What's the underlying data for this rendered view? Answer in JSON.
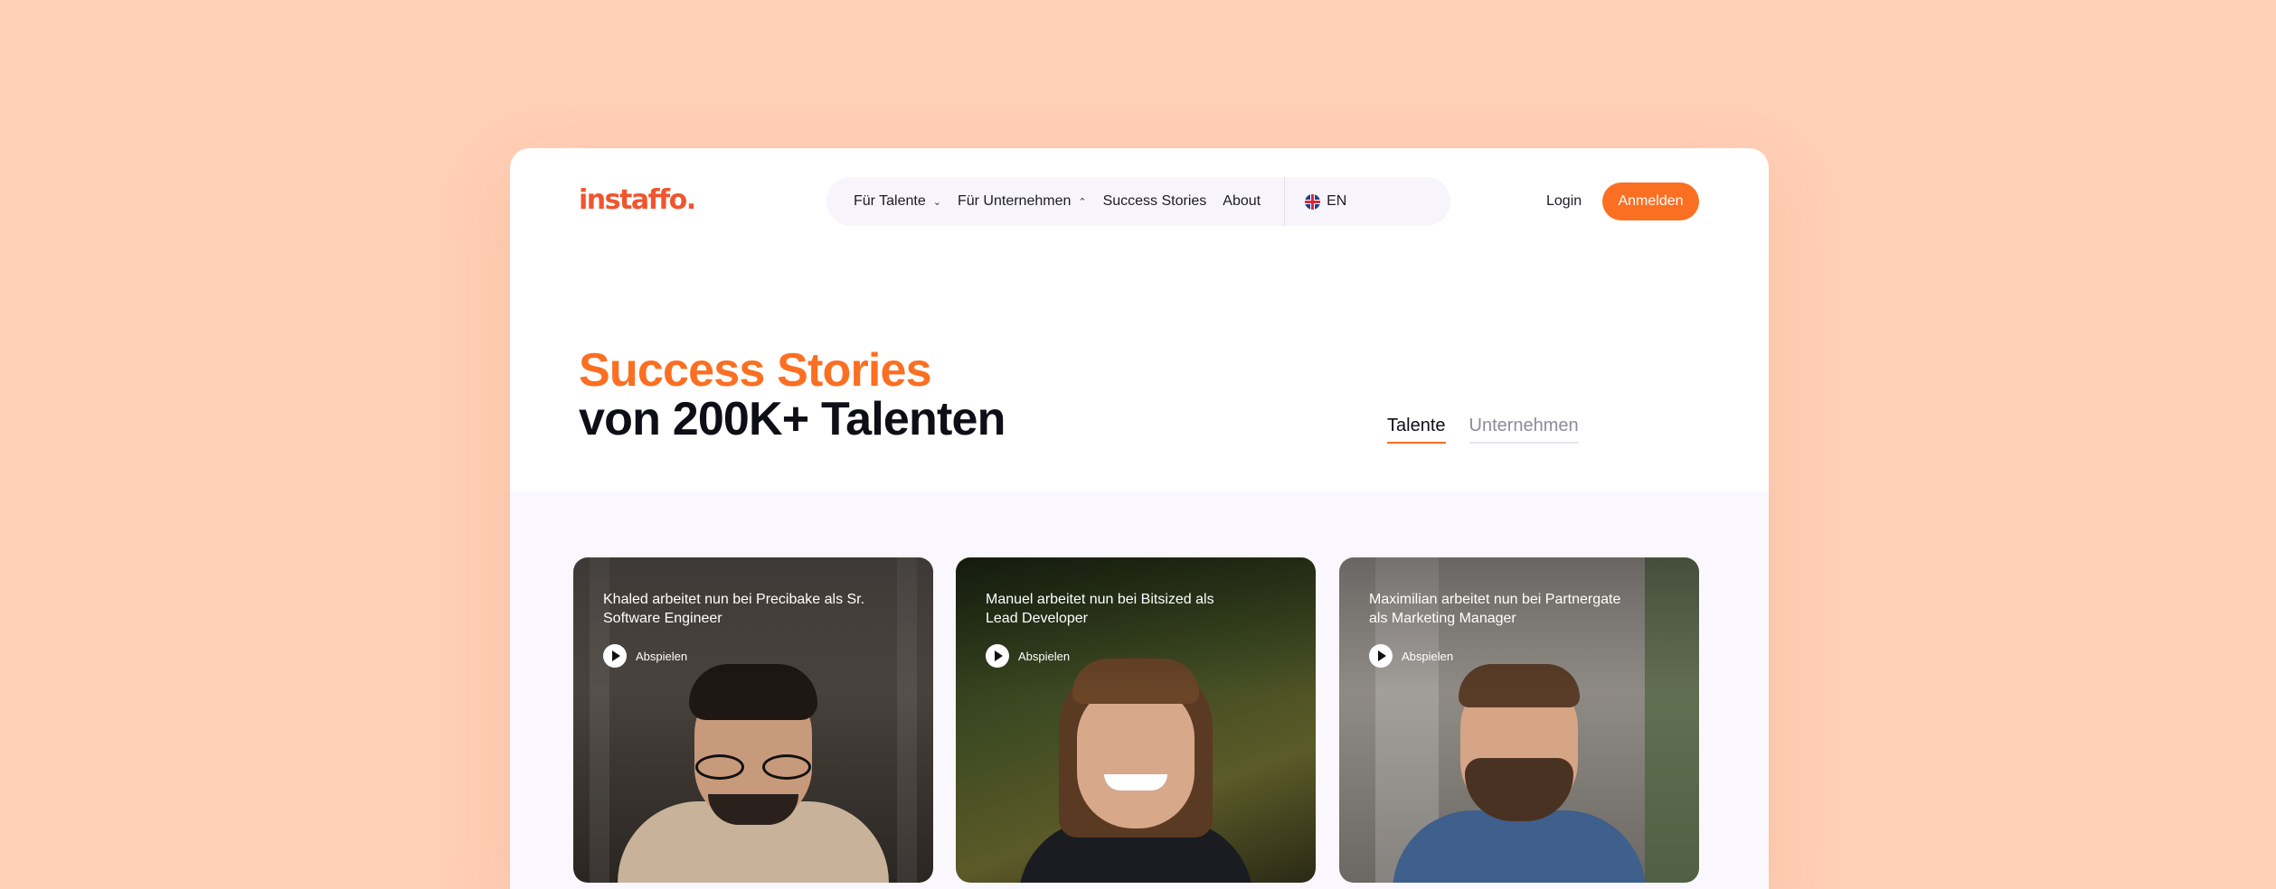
{
  "header": {
    "logo": "instaffo.",
    "nav": [
      {
        "label": "Für Talente",
        "chevron": "chevron-down-icon"
      },
      {
        "label": "Für Unternehmen",
        "chevron": "chevron-up-icon"
      },
      {
        "label": "Success Stories"
      },
      {
        "label": "About"
      }
    ],
    "language": "EN",
    "login": "Login",
    "signup": "Anmelden"
  },
  "hero": {
    "title_accent": "Success Stories",
    "title_main": "von 200K+ Talenten",
    "tabs": [
      "Talente",
      "Unternehmen"
    ],
    "active_tab": "Talente"
  },
  "stories": [
    {
      "text": "Khaled arbeitet nun bei Precibake als Sr. Software Engineer",
      "play": "Abspielen"
    },
    {
      "text": "Manuel arbeitet nun bei Bitsized als Lead Developer",
      "play": "Abspielen"
    },
    {
      "text": "Maximilian arbeitet nun bei Partnergate als Marketing Manager",
      "play": "Abspielen"
    }
  ],
  "colors": {
    "background": "#ffcfb6",
    "accent": "#fb6f22",
    "logo": "#f0552d",
    "text": "#0e0e16"
  }
}
